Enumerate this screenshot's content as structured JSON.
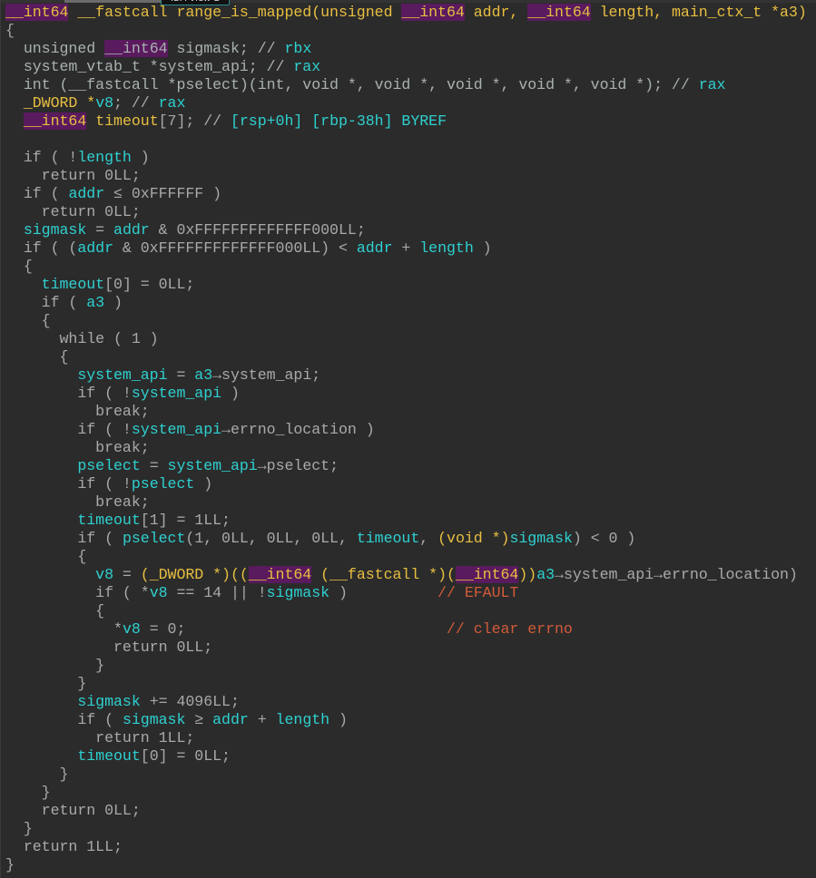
{
  "window": {
    "tooltip": "IDA View-B"
  },
  "colors": {
    "background": "#2b2b2b",
    "function_signature": "#e8bf40",
    "variable": "#2fd0d0",
    "keyword": "#a9a9a9",
    "comment": "#d25a3a",
    "type_highlight": "#5a1a5e"
  },
  "code": {
    "function_name": "range_is_mapped",
    "lines": [
      [
        {
          "k": "y",
          "h": 1,
          "v": "__int64"
        },
        {
          "k": "y",
          "v": " __fastcall range_is_mapped(unsigned "
        },
        {
          "k": "y",
          "h": 1,
          "v": "__int64"
        },
        {
          "k": "y",
          "v": " addr, "
        },
        {
          "k": "y",
          "h": 1,
          "v": "__int64"
        },
        {
          "k": "y",
          "v": " length, main_ctx_t *a3)"
        }
      ],
      [
        {
          "k": "g",
          "v": "{"
        }
      ],
      [
        {
          "k": "t",
          "v": "  unsigned "
        },
        {
          "k": "t",
          "h": 1,
          "v": "__int64"
        },
        {
          "k": "t",
          "v": " sigmask; // "
        },
        {
          "k": "c",
          "v": "rbx"
        }
      ],
      [
        {
          "k": "t",
          "v": "  system_vtab_t *system_api; // "
        },
        {
          "k": "c",
          "v": "rax"
        }
      ],
      [
        {
          "k": "t",
          "v": "  int (__fastcall *pselect)(int, void *, void *, void *, void *, void *); // "
        },
        {
          "k": "c",
          "v": "rax"
        }
      ],
      [
        {
          "k": "y",
          "v": "  _DWORD *"
        },
        {
          "k": "c",
          "v": "v8"
        },
        {
          "k": "g",
          "v": "; // "
        },
        {
          "k": "c",
          "v": "rax"
        }
      ],
      [
        {
          "k": "y",
          "v": "  "
        },
        {
          "k": "y",
          "h": 1,
          "v": "__int64"
        },
        {
          "k": "y",
          "v": " timeout"
        },
        {
          "k": "g",
          "v": "[7]; // "
        },
        {
          "k": "c",
          "v": "[rsp+0h] [rbp-38h] BYREF"
        }
      ],
      [],
      [
        {
          "k": "g",
          "v": "  if ( !"
        },
        {
          "k": "c",
          "v": "length"
        },
        {
          "k": "g",
          "v": " )"
        }
      ],
      [
        {
          "k": "g",
          "v": "    return 0LL;"
        }
      ],
      [
        {
          "k": "g",
          "v": "  if ( "
        },
        {
          "k": "c",
          "v": "addr"
        },
        {
          "k": "g",
          "v": " ≤ 0xFFFFFF )"
        }
      ],
      [
        {
          "k": "g",
          "v": "    return 0LL;"
        }
      ],
      [
        {
          "k": "c",
          "v": "  sigmask"
        },
        {
          "k": "g",
          "v": " = "
        },
        {
          "k": "c",
          "v": "addr"
        },
        {
          "k": "g",
          "v": " & 0xFFFFFFFFFFFFF000LL;"
        }
      ],
      [
        {
          "k": "g",
          "v": "  if ( ("
        },
        {
          "k": "c",
          "v": "addr"
        },
        {
          "k": "g",
          "v": " & 0xFFFFFFFFFFFFF000LL) < "
        },
        {
          "k": "c",
          "v": "addr"
        },
        {
          "k": "g",
          "v": " + "
        },
        {
          "k": "c",
          "v": "length"
        },
        {
          "k": "g",
          "v": " )"
        }
      ],
      [
        {
          "k": "g",
          "v": "  {"
        }
      ],
      [
        {
          "k": "c",
          "v": "    timeout"
        },
        {
          "k": "g",
          "v": "[0] = 0LL;"
        }
      ],
      [
        {
          "k": "g",
          "v": "    if ( "
        },
        {
          "k": "c",
          "v": "a3"
        },
        {
          "k": "g",
          "v": " )"
        }
      ],
      [
        {
          "k": "g",
          "v": "    {"
        }
      ],
      [
        {
          "k": "g",
          "v": "      while ( 1 )"
        }
      ],
      [
        {
          "k": "g",
          "v": "      {"
        }
      ],
      [
        {
          "k": "c",
          "v": "        system_api"
        },
        {
          "k": "g",
          "v": " = "
        },
        {
          "k": "c",
          "v": "a3"
        },
        {
          "k": "g",
          "v": "→system_api;"
        }
      ],
      [
        {
          "k": "g",
          "v": "        if ( !"
        },
        {
          "k": "c",
          "v": "system_api"
        },
        {
          "k": "g",
          "v": " )"
        }
      ],
      [
        {
          "k": "g",
          "v": "          break;"
        }
      ],
      [
        {
          "k": "g",
          "v": "        if ( !"
        },
        {
          "k": "c",
          "v": "system_api"
        },
        {
          "k": "g",
          "v": "→errno_location )"
        }
      ],
      [
        {
          "k": "g",
          "v": "          break;"
        }
      ],
      [
        {
          "k": "c",
          "v": "        pselect"
        },
        {
          "k": "g",
          "v": " = "
        },
        {
          "k": "c",
          "v": "system_api"
        },
        {
          "k": "g",
          "v": "→pselect;"
        }
      ],
      [
        {
          "k": "g",
          "v": "        if ( !"
        },
        {
          "k": "c",
          "v": "pselect"
        },
        {
          "k": "g",
          "v": " )"
        }
      ],
      [
        {
          "k": "g",
          "v": "          break;"
        }
      ],
      [
        {
          "k": "c",
          "v": "        timeout"
        },
        {
          "k": "g",
          "v": "[1] = 1LL;"
        }
      ],
      [
        {
          "k": "g",
          "v": "        if ( "
        },
        {
          "k": "c",
          "v": "pselect"
        },
        {
          "k": "g",
          "v": "(1, 0LL, 0LL, 0LL, "
        },
        {
          "k": "c",
          "v": "timeout"
        },
        {
          "k": "g",
          "v": ", "
        },
        {
          "k": "y",
          "v": "(void *)"
        },
        {
          "k": "c",
          "v": "sigmask"
        },
        {
          "k": "g",
          "v": ") < 0 )"
        }
      ],
      [
        {
          "k": "g",
          "v": "        {"
        }
      ],
      [
        {
          "k": "c",
          "v": "          v8"
        },
        {
          "k": "g",
          "v": " = "
        },
        {
          "k": "y",
          "v": "(_DWORD *)(("
        },
        {
          "k": "y",
          "h": 1,
          "v": "__int64"
        },
        {
          "k": "y",
          "v": " (__fastcall *)("
        },
        {
          "k": "y",
          "h": 1,
          "v": "__int64"
        },
        {
          "k": "y",
          "v": "))"
        },
        {
          "k": "c",
          "v": "a3"
        },
        {
          "k": "g",
          "v": "→system_api→errno_location)"
        }
      ],
      [
        {
          "k": "g",
          "v": "          if ( *"
        },
        {
          "k": "c",
          "v": "v8"
        },
        {
          "k": "g",
          "v": " == 14 || !"
        },
        {
          "k": "c",
          "v": "sigmask"
        },
        {
          "k": "g",
          "v": " )          "
        },
        {
          "k": "cm",
          "v": "// EFAULT"
        }
      ],
      [
        {
          "k": "g",
          "v": "          {"
        }
      ],
      [
        {
          "k": "g",
          "v": "            *"
        },
        {
          "k": "c",
          "v": "v8"
        },
        {
          "k": "g",
          "v": " = 0;                             "
        },
        {
          "k": "cm",
          "v": "// clear errno"
        }
      ],
      [
        {
          "k": "g",
          "v": "            return 0LL;"
        }
      ],
      [
        {
          "k": "g",
          "v": "          }"
        }
      ],
      [
        {
          "k": "g",
          "v": "        }"
        }
      ],
      [
        {
          "k": "c",
          "v": "        sigmask"
        },
        {
          "k": "g",
          "v": " += 4096LL;"
        }
      ],
      [
        {
          "k": "g",
          "v": "        if ( "
        },
        {
          "k": "c",
          "v": "sigmask"
        },
        {
          "k": "g",
          "v": " ≥ "
        },
        {
          "k": "c",
          "v": "addr"
        },
        {
          "k": "g",
          "v": " + "
        },
        {
          "k": "c",
          "v": "length"
        },
        {
          "k": "g",
          "v": " )"
        }
      ],
      [
        {
          "k": "g",
          "v": "          return 1LL;"
        }
      ],
      [
        {
          "k": "c",
          "v": "        timeout"
        },
        {
          "k": "g",
          "v": "[0] = 0LL;"
        }
      ],
      [
        {
          "k": "g",
          "v": "      }"
        }
      ],
      [
        {
          "k": "g",
          "v": "    }"
        }
      ],
      [
        {
          "k": "g",
          "v": "    return 0LL;"
        }
      ],
      [
        {
          "k": "g",
          "v": "  }"
        }
      ],
      [
        {
          "k": "g",
          "v": "  return 1LL;"
        }
      ],
      [
        {
          "k": "g",
          "v": "}"
        }
      ]
    ]
  }
}
